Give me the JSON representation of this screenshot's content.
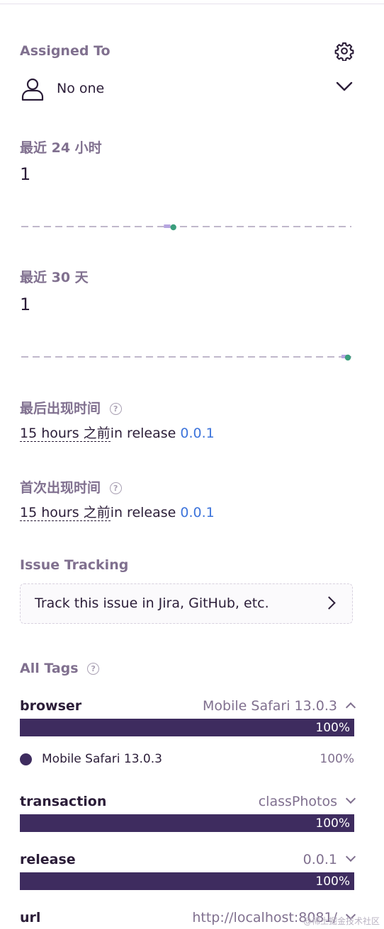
{
  "assigned": {
    "heading": "Assigned To",
    "value": "No one",
    "icons": {
      "settings": "gear-icon",
      "user": "user-icon",
      "toggle": "chevron-down-icon"
    }
  },
  "stats24h": {
    "heading": "最近 24 小时",
    "count": "1",
    "series": [
      0,
      0,
      0,
      0,
      0,
      0,
      0,
      0,
      0,
      0,
      0,
      0,
      1,
      0,
      0,
      0,
      0,
      0,
      0,
      0,
      0,
      0,
      0,
      0,
      0,
      0,
      0,
      0
    ]
  },
  "stats30d": {
    "heading": "最近 30 天",
    "count": "1",
    "series": [
      0,
      0,
      0,
      0,
      0,
      0,
      0,
      0,
      0,
      0,
      0,
      0,
      0,
      0,
      0,
      0,
      0,
      0,
      0,
      0,
      0,
      0,
      0,
      0,
      0,
      0,
      0,
      0,
      0,
      1
    ]
  },
  "last_seen": {
    "heading": "最后出现时间",
    "time": "15 hours 之前",
    "in_release": "in release",
    "release": "0.0.1"
  },
  "first_seen": {
    "heading": "首次出现时间",
    "time": "15 hours 之前",
    "in_release": "in release",
    "release": "0.0.1"
  },
  "issue_tracking": {
    "heading": "Issue Tracking",
    "cta": "Track this issue in Jira, GitHub, etc."
  },
  "tags": {
    "heading": "All Tags",
    "items": [
      {
        "key": "browser",
        "value": "Mobile Safari 13.0.3",
        "percent": "100%",
        "fraction": 1.0,
        "expanded": true
      },
      {
        "key": "transaction",
        "value": "classPhotos",
        "percent": "100%",
        "fraction": 1.0,
        "expanded": false
      },
      {
        "key": "release",
        "value": "0.0.1",
        "percent": "100%",
        "fraction": 1.0,
        "expanded": false
      },
      {
        "key": "url",
        "value": "http://localhost:8081/",
        "percent": "",
        "fraction": 1.0,
        "expanded": false
      }
    ],
    "browser_breakdown": {
      "name": "Mobile Safari 13.0.3",
      "percent": "100%"
    }
  },
  "colors": {
    "accent": "#3e2c5f",
    "spark_bar": "#b6a5e0",
    "spark_dot": "#3b9e7d",
    "link": "#3d74db"
  },
  "watermark": "@稀土掘金技术社区"
}
